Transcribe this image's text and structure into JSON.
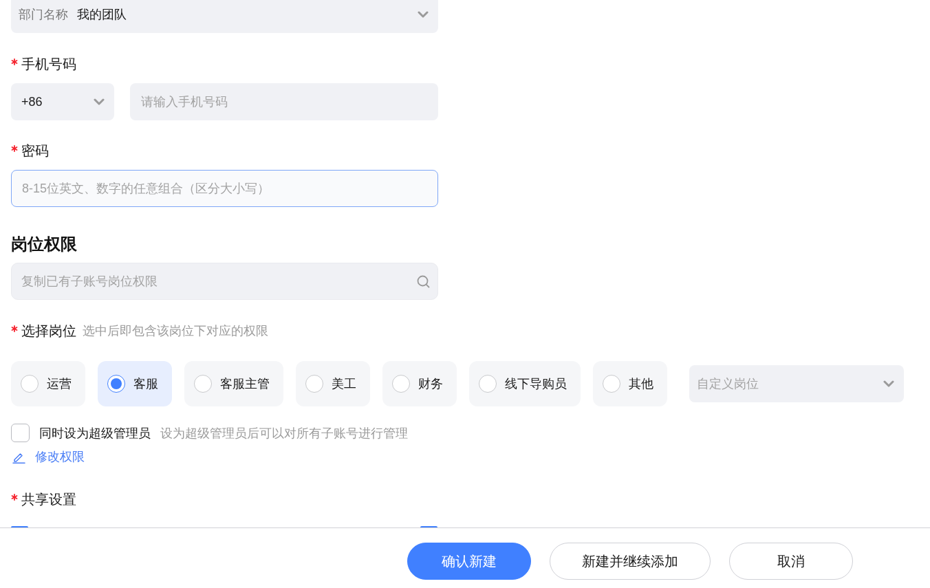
{
  "department": {
    "label": "部门名称",
    "value": "我的团队"
  },
  "phone": {
    "label": "手机号码",
    "required": true,
    "country_code": "+86",
    "placeholder": "请输入手机号码"
  },
  "password": {
    "label": "密码",
    "required": true,
    "placeholder": "8-15位英文、数字的任意组合（区分大小写）",
    "focused": true
  },
  "section_title": "岗位权限",
  "copy_search": {
    "placeholder": "复制已有子账号岗位权限"
  },
  "position": {
    "label": "选择岗位",
    "required": true,
    "hint": "选中后即包含该岗位下对应的权限",
    "options": [
      {
        "label": "运营",
        "selected": false
      },
      {
        "label": "客服",
        "selected": true
      },
      {
        "label": "客服主管",
        "selected": false
      },
      {
        "label": "美工",
        "selected": false
      },
      {
        "label": "财务",
        "selected": false
      },
      {
        "label": "线下导购员",
        "selected": false
      },
      {
        "label": "其他",
        "selected": false
      }
    ],
    "custom": {
      "placeholder": "自定义岗位"
    }
  },
  "super_admin": {
    "label": "同时设为超级管理员",
    "hint": "设为超级管理员后可以对所有子账号进行管理",
    "checked": false
  },
  "edit_link": "修改权限",
  "share_settings": {
    "label": "共享设置",
    "required": true,
    "options": [
      {
        "checked": true
      },
      {
        "checked": true
      }
    ]
  },
  "buttons": [
    {
      "label": "确认新建",
      "kind": "primary"
    },
    {
      "label": "新建并继续添加",
      "kind": "default"
    },
    {
      "label": "取消",
      "kind": "default"
    }
  ]
}
